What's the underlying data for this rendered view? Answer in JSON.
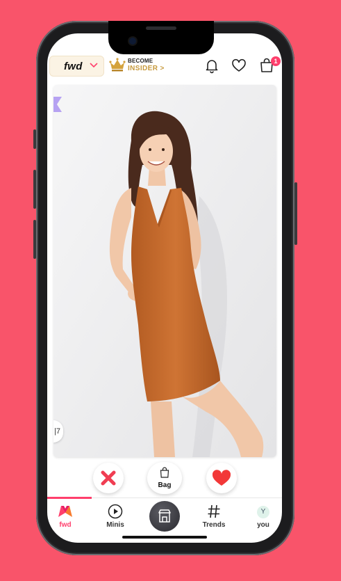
{
  "header": {
    "brand_label": "fwd",
    "insider_line1": "BECOME",
    "insider_line2": "INSIDER >",
    "cart_count": "1"
  },
  "card": {
    "side_tab_label": "|7"
  },
  "actions": {
    "bag_label": "Bag"
  },
  "nav": {
    "items": [
      {
        "label": "fwd",
        "icon": "myntra-logo-icon",
        "active": true
      },
      {
        "label": "Minis",
        "icon": "play-circle-icon"
      },
      {
        "label": "",
        "icon": "store-icon"
      },
      {
        "label": "Trends",
        "icon": "hashtag-icon"
      },
      {
        "label": "you",
        "icon": "avatar-icon",
        "avatar_letter": "Y"
      }
    ]
  },
  "colors": {
    "background": "#f9546a",
    "accent": "#ff3f6c",
    "insider_gold": "#c79a3d",
    "dress": "#c2682c"
  }
}
